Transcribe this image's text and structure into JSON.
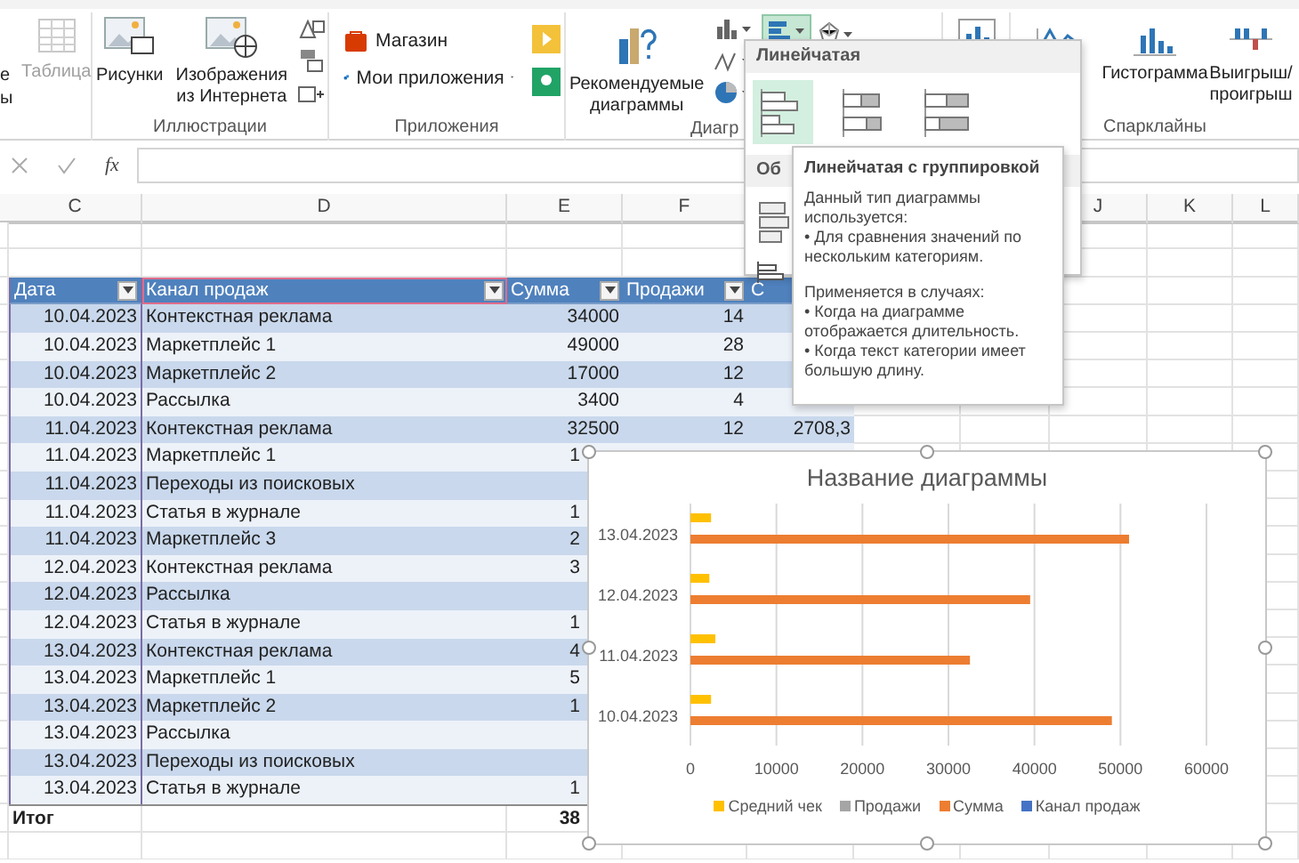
{
  "ribbon": {
    "cut_group": {
      "lines": [
        "е",
        "ы"
      ]
    },
    "table_button": {
      "label": "Таблица",
      "disabled": true
    },
    "illustrations": {
      "label": "Иллюстрации",
      "buttons": [
        {
          "lines": [
            "Рисунки"
          ]
        },
        {
          "lines": [
            "Изображения",
            "из Интернета"
          ]
        }
      ]
    },
    "apps": {
      "label": "Приложения",
      "items": [
        {
          "label": "Магазин",
          "has_menu": false
        },
        {
          "label": "Мои приложения",
          "has_menu": true
        }
      ]
    },
    "charts": {
      "label": "Диагр",
      "recommended": {
        "lines": [
          "Рекомендуемые",
          "диаграммы"
        ]
      },
      "bar_button_selected": true
    },
    "sparklines": {
      "label": "Спарклайны",
      "buttons": [
        {
          "kind": "line"
        },
        {
          "kind": "column",
          "lines": [
            "Гистограмма"
          ]
        },
        {
          "kind": "winloss",
          "lines": [
            "Выигрыш/",
            "проигрыш"
          ]
        }
      ]
    }
  },
  "formula_bar": {
    "function_label": "fx"
  },
  "column_headers": [
    {
      "label": "C"
    },
    {
      "label": "D"
    },
    {
      "label": "E"
    },
    {
      "label": "F"
    },
    {
      "label": "J"
    },
    {
      "label": "K"
    },
    {
      "label": "L"
    }
  ],
  "table": {
    "columns": [
      {
        "label": "Дата"
      },
      {
        "label": "Канал продаж"
      },
      {
        "label": "Сумма"
      },
      {
        "label": "Продажи"
      },
      {
        "label": "С"
      }
    ],
    "rows": [
      {
        "kind": "full",
        "date": "10.04.2023",
        "channel": "Контекстная реклама",
        "sum": "34000",
        "sales": "14"
      },
      {
        "kind": "full",
        "date": "10.04.2023",
        "channel": "Маркетплейс 1",
        "sum": "49000",
        "sales": "28"
      },
      {
        "kind": "full",
        "date": "10.04.2023",
        "channel": "Маркетплейс 2",
        "sum": "17000",
        "sales": "12"
      },
      {
        "kind": "full",
        "date": "10.04.2023",
        "channel": "Рассылка",
        "sum": "3400",
        "sales": "4"
      },
      {
        "kind": "full",
        "date": "11.04.2023",
        "channel": "Контекстная реклама",
        "sum": "32500",
        "sales": "12",
        "avg": "2708,3"
      },
      {
        "kind": "cut",
        "date": "11.04.2023",
        "channel": "Маркетплейс 1",
        "sum": "1"
      },
      {
        "kind": "cut",
        "date": "11.04.2023",
        "channel": "Переходы из поисковых"
      },
      {
        "kind": "cut",
        "date": "11.04.2023",
        "channel": "Статья в журнале",
        "sum": "1"
      },
      {
        "kind": "cut",
        "date": "11.04.2023",
        "channel": "Маркетплейс 3",
        "sum": "2"
      },
      {
        "kind": "cut",
        "date": "12.04.2023",
        "channel": "Контекстная реклама",
        "sum": "3"
      },
      {
        "kind": "cut",
        "date": "12.04.2023",
        "channel": "Рассылка"
      },
      {
        "kind": "cut",
        "date": "12.04.2023",
        "channel": "Статья в журнале",
        "sum": "1"
      },
      {
        "kind": "cut",
        "date": "13.04.2023",
        "channel": "Контекстная реклама",
        "sum": "4"
      },
      {
        "kind": "cut",
        "date": "13.04.2023",
        "channel": "Маркетплейс 1",
        "sum": "5"
      },
      {
        "kind": "cut",
        "date": "13.04.2023",
        "channel": "Маркетплейс 2",
        "sum": "1"
      },
      {
        "kind": "cut",
        "date": "13.04.2023",
        "channel": "Рассылка"
      },
      {
        "kind": "cut",
        "date": "13.04.2023",
        "channel": "Переходы из поисковых"
      },
      {
        "kind": "cut",
        "date": "13.04.2023",
        "channel": "Статья в журнале",
        "sum": "1"
      }
    ],
    "total": {
      "label": "Итог",
      "sum": "38"
    }
  },
  "bar_menu": {
    "heading": "Линейчатая",
    "options": [
      {
        "kind": "clustered",
        "selected": true
      },
      {
        "kind": "stacked",
        "selected": false
      },
      {
        "kind": "stacked100",
        "selected": false
      }
    ],
    "section_heading": "Об"
  },
  "tooltip": {
    "title": "Линейчатая с группировкой",
    "sections": [
      [
        "Данный тип диаграммы используется:",
        "• Для сравнения значений по нескольким категориям."
      ],
      [
        "Применяется в случаях:",
        "• Когда на диаграмме отображается длительность.",
        "• Когда текст категории имеет большую длину."
      ]
    ]
  },
  "chart": {
    "chart_data": {
      "type": "bar",
      "orientation": "horizontal",
      "title": "Название диаграммы",
      "categories": [
        "13.04.2023",
        "12.04.2023",
        "11.04.2023",
        "10.04.2023"
      ],
      "series": [
        {
          "name": "Средний чек",
          "color": "#ffc000",
          "values": [
            2400,
            2200,
            2900,
            2400
          ]
        },
        {
          "name": "Продажи",
          "color": "#a5a5a5",
          "values": [
            null,
            null,
            null,
            null
          ]
        },
        {
          "name": "Сумма",
          "color": "#ed7d31",
          "values": [
            51000,
            39500,
            32500,
            49000
          ]
        },
        {
          "name": "Канал продаж",
          "color": "#4472c4",
          "values": [
            null,
            null,
            null,
            null
          ]
        }
      ],
      "xlim": [
        0,
        60000
      ],
      "xticks": [
        0,
        10000,
        20000,
        30000,
        40000,
        50000,
        60000
      ],
      "grid": true,
      "legend": true
    }
  }
}
